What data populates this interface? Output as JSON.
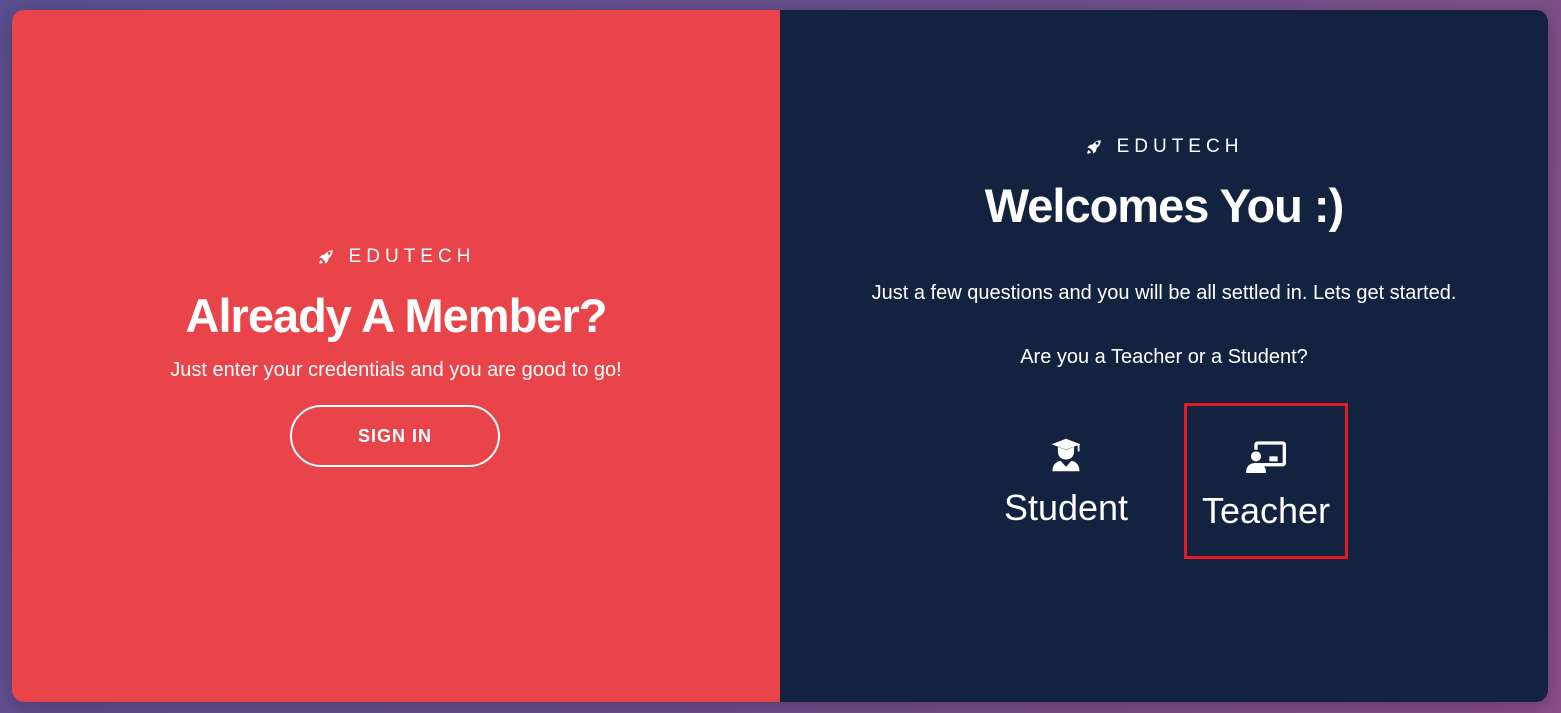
{
  "left_panel": {
    "brand": "EDUTECH",
    "brand_icon": "rocket-icon",
    "title": "Already A Member?",
    "subtitle": "Just enter your credentials and you are good to go!",
    "signin_label": "SIGN IN",
    "background": "#e94449"
  },
  "right_panel": {
    "brand": "EDUTECH",
    "brand_icon": "rocket-icon",
    "title": "Welcomes You :)",
    "description": "Just a few questions and you will be all settled in. Lets get started.",
    "question": "Are you a Teacher or a Student?",
    "background": "#13223f",
    "roles": [
      {
        "label": "Student",
        "icon": "graduate-icon",
        "selected": false
      },
      {
        "label": "Teacher",
        "icon": "teacher-board-icon",
        "selected": true
      }
    ],
    "highlight_color": "#e21b24"
  }
}
